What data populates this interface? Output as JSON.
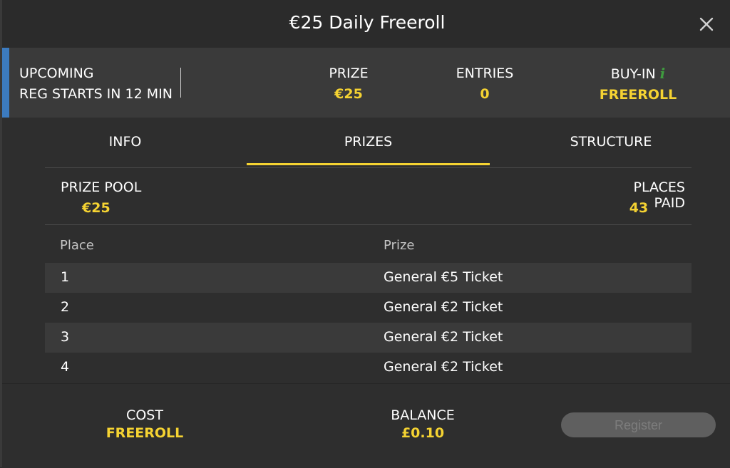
{
  "dialog": {
    "title": "€25 Daily Freeroll"
  },
  "status": {
    "state": "UPCOMING",
    "reg_info": "REG STARTS IN 12 MIN",
    "prize_label": "PRIZE",
    "prize_value": "€25",
    "entries_label": "ENTRIES",
    "entries_value": "0",
    "buyin_label": "BUY-IN",
    "buyin_value": "FREEROLL",
    "info_icon": "i"
  },
  "tabs": [
    {
      "label": "INFO",
      "active": false
    },
    {
      "label": "PRIZES",
      "active": true
    },
    {
      "label": "STRUCTURE",
      "active": false
    }
  ],
  "summary": {
    "pool_label": "PRIZE POOL",
    "pool_value": "€25",
    "paid_label": "PLACES PAID",
    "paid_value": "43"
  },
  "table": {
    "headers": [
      "Place",
      "Prize"
    ],
    "rows": [
      {
        "place": "1",
        "prize": "General €5 Ticket"
      },
      {
        "place": "2",
        "prize": "General €2 Ticket"
      },
      {
        "place": "3",
        "prize": "General €2 Ticket"
      },
      {
        "place": "4",
        "prize": "General €2 Ticket"
      }
    ]
  },
  "footer": {
    "cost_label": "COST",
    "cost_value": "FREEROLL",
    "balance_label": "BALANCE",
    "balance_value": "£0.10",
    "register_label": "Register"
  },
  "colors": {
    "accent_yellow": "#f5d332",
    "info_green": "#3f9b3f",
    "status_blue": "#3c7bbf"
  }
}
